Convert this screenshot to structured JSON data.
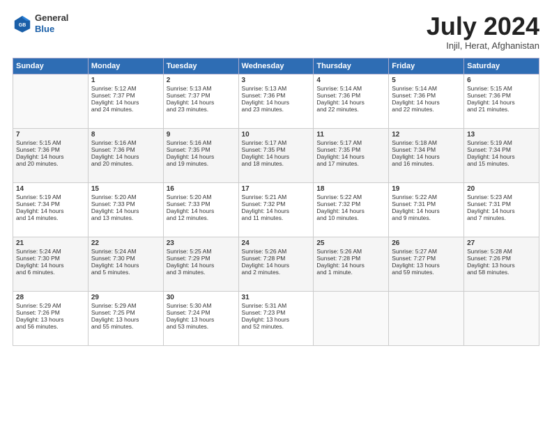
{
  "header": {
    "logo_general": "General",
    "logo_blue": "Blue",
    "title": "July 2024",
    "location": "Injil, Herat, Afghanistan"
  },
  "columns": [
    "Sunday",
    "Monday",
    "Tuesday",
    "Wednesday",
    "Thursday",
    "Friday",
    "Saturday"
  ],
  "weeks": [
    [
      {
        "day": "",
        "info": ""
      },
      {
        "day": "1",
        "info": "Sunrise: 5:12 AM\nSunset: 7:37 PM\nDaylight: 14 hours\nand 24 minutes."
      },
      {
        "day": "2",
        "info": "Sunrise: 5:13 AM\nSunset: 7:37 PM\nDaylight: 14 hours\nand 23 minutes."
      },
      {
        "day": "3",
        "info": "Sunrise: 5:13 AM\nSunset: 7:36 PM\nDaylight: 14 hours\nand 23 minutes."
      },
      {
        "day": "4",
        "info": "Sunrise: 5:14 AM\nSunset: 7:36 PM\nDaylight: 14 hours\nand 22 minutes."
      },
      {
        "day": "5",
        "info": "Sunrise: 5:14 AM\nSunset: 7:36 PM\nDaylight: 14 hours\nand 22 minutes."
      },
      {
        "day": "6",
        "info": "Sunrise: 5:15 AM\nSunset: 7:36 PM\nDaylight: 14 hours\nand 21 minutes."
      }
    ],
    [
      {
        "day": "7",
        "info": "Sunrise: 5:15 AM\nSunset: 7:36 PM\nDaylight: 14 hours\nand 20 minutes."
      },
      {
        "day": "8",
        "info": "Sunrise: 5:16 AM\nSunset: 7:36 PM\nDaylight: 14 hours\nand 20 minutes."
      },
      {
        "day": "9",
        "info": "Sunrise: 5:16 AM\nSunset: 7:35 PM\nDaylight: 14 hours\nand 19 minutes."
      },
      {
        "day": "10",
        "info": "Sunrise: 5:17 AM\nSunset: 7:35 PM\nDaylight: 14 hours\nand 18 minutes."
      },
      {
        "day": "11",
        "info": "Sunrise: 5:17 AM\nSunset: 7:35 PM\nDaylight: 14 hours\nand 17 minutes."
      },
      {
        "day": "12",
        "info": "Sunrise: 5:18 AM\nSunset: 7:34 PM\nDaylight: 14 hours\nand 16 minutes."
      },
      {
        "day": "13",
        "info": "Sunrise: 5:19 AM\nSunset: 7:34 PM\nDaylight: 14 hours\nand 15 minutes."
      }
    ],
    [
      {
        "day": "14",
        "info": "Sunrise: 5:19 AM\nSunset: 7:34 PM\nDaylight: 14 hours\nand 14 minutes."
      },
      {
        "day": "15",
        "info": "Sunrise: 5:20 AM\nSunset: 7:33 PM\nDaylight: 14 hours\nand 13 minutes."
      },
      {
        "day": "16",
        "info": "Sunrise: 5:20 AM\nSunset: 7:33 PM\nDaylight: 14 hours\nand 12 minutes."
      },
      {
        "day": "17",
        "info": "Sunrise: 5:21 AM\nSunset: 7:32 PM\nDaylight: 14 hours\nand 11 minutes."
      },
      {
        "day": "18",
        "info": "Sunrise: 5:22 AM\nSunset: 7:32 PM\nDaylight: 14 hours\nand 10 minutes."
      },
      {
        "day": "19",
        "info": "Sunrise: 5:22 AM\nSunset: 7:31 PM\nDaylight: 14 hours\nand 9 minutes."
      },
      {
        "day": "20",
        "info": "Sunrise: 5:23 AM\nSunset: 7:31 PM\nDaylight: 14 hours\nand 7 minutes."
      }
    ],
    [
      {
        "day": "21",
        "info": "Sunrise: 5:24 AM\nSunset: 7:30 PM\nDaylight: 14 hours\nand 6 minutes."
      },
      {
        "day": "22",
        "info": "Sunrise: 5:24 AM\nSunset: 7:30 PM\nDaylight: 14 hours\nand 5 minutes."
      },
      {
        "day": "23",
        "info": "Sunrise: 5:25 AM\nSunset: 7:29 PM\nDaylight: 14 hours\nand 3 minutes."
      },
      {
        "day": "24",
        "info": "Sunrise: 5:26 AM\nSunset: 7:28 PM\nDaylight: 14 hours\nand 2 minutes."
      },
      {
        "day": "25",
        "info": "Sunrise: 5:26 AM\nSunset: 7:28 PM\nDaylight: 14 hours\nand 1 minute."
      },
      {
        "day": "26",
        "info": "Sunrise: 5:27 AM\nSunset: 7:27 PM\nDaylight: 13 hours\nand 59 minutes."
      },
      {
        "day": "27",
        "info": "Sunrise: 5:28 AM\nSunset: 7:26 PM\nDaylight: 13 hours\nand 58 minutes."
      }
    ],
    [
      {
        "day": "28",
        "info": "Sunrise: 5:29 AM\nSunset: 7:26 PM\nDaylight: 13 hours\nand 56 minutes."
      },
      {
        "day": "29",
        "info": "Sunrise: 5:29 AM\nSunset: 7:25 PM\nDaylight: 13 hours\nand 55 minutes."
      },
      {
        "day": "30",
        "info": "Sunrise: 5:30 AM\nSunset: 7:24 PM\nDaylight: 13 hours\nand 53 minutes."
      },
      {
        "day": "31",
        "info": "Sunrise: 5:31 AM\nSunset: 7:23 PM\nDaylight: 13 hours\nand 52 minutes."
      },
      {
        "day": "",
        "info": ""
      },
      {
        "day": "",
        "info": ""
      },
      {
        "day": "",
        "info": ""
      }
    ]
  ]
}
